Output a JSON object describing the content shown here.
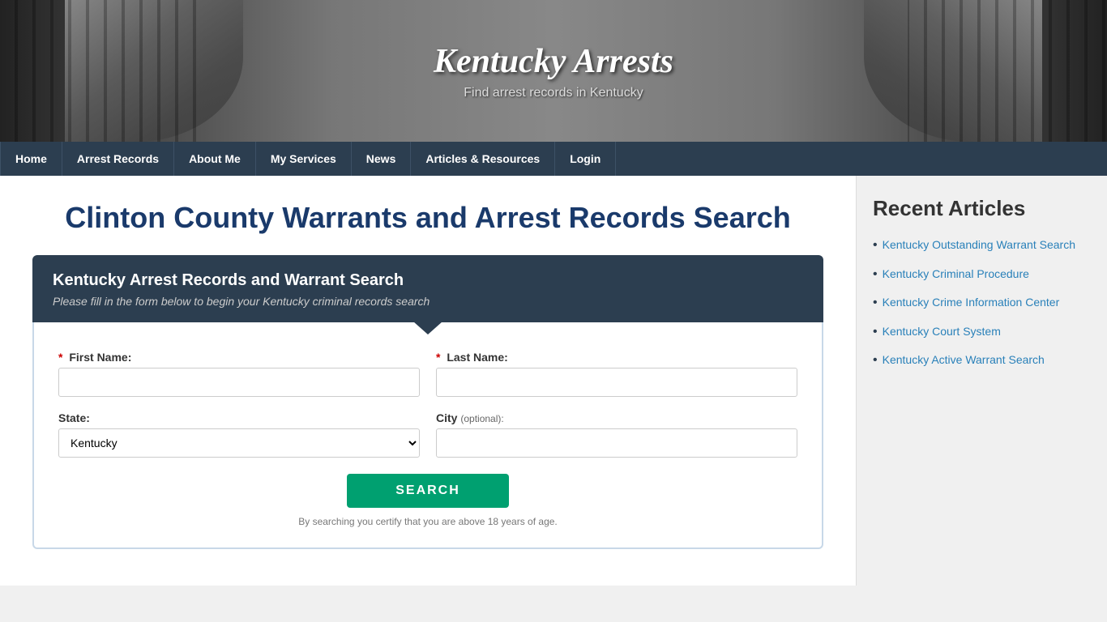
{
  "header": {
    "title": "Kentucky Arrests",
    "subtitle": "Find arrest records in Kentucky"
  },
  "nav": {
    "items": [
      {
        "label": "Home",
        "active": false
      },
      {
        "label": "Arrest Records",
        "active": false
      },
      {
        "label": "About Me",
        "active": false
      },
      {
        "label": "My Services",
        "active": false
      },
      {
        "label": "News",
        "active": false
      },
      {
        "label": "Articles & Resources",
        "active": false
      },
      {
        "label": "Login",
        "active": false
      }
    ]
  },
  "main": {
    "page_title": "Clinton County Warrants and Arrest Records Search",
    "search_box": {
      "heading": "Kentucky Arrest Records and Warrant Search",
      "subheading": "Please fill in the form below to begin your Kentucky criminal records search",
      "first_name_label": "First Name:",
      "last_name_label": "Last Name:",
      "state_label": "State:",
      "city_label": "City",
      "city_optional": "(optional):",
      "state_default": "Kentucky",
      "search_button": "SEARCH",
      "disclaimer": "By searching you certify that you are above 18 years of age."
    }
  },
  "sidebar": {
    "title": "Recent Articles",
    "articles": [
      {
        "label": "Kentucky Outstanding Warrant Search",
        "href": "#"
      },
      {
        "label": "Kentucky Criminal Procedure",
        "href": "#"
      },
      {
        "label": "Kentucky Crime Information Center",
        "href": "#"
      },
      {
        "label": "Kentucky Court System",
        "href": "#"
      },
      {
        "label": "Kentucky Active Warrant Search",
        "href": "#"
      }
    ]
  }
}
